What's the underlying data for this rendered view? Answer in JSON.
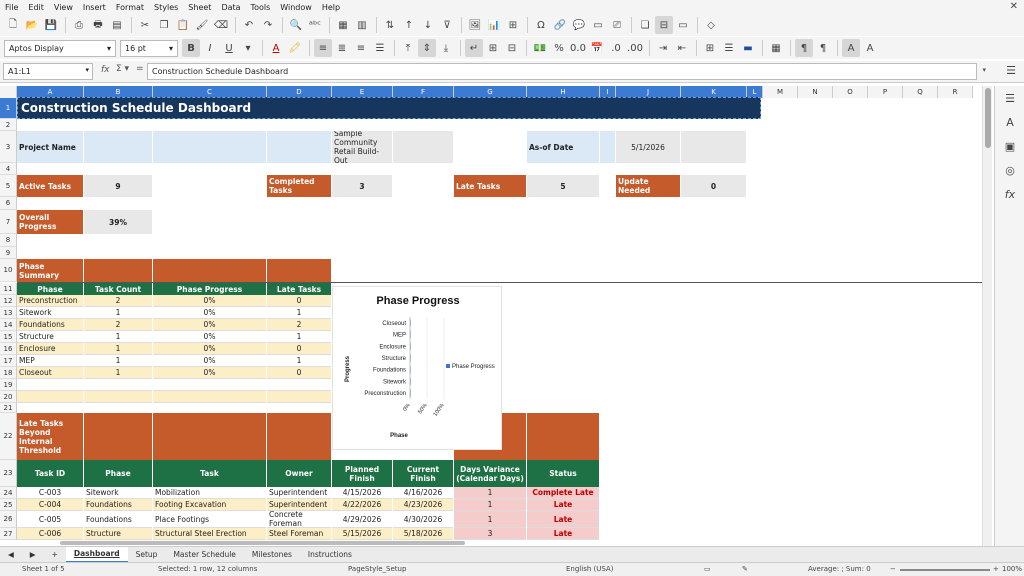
{
  "menu": [
    "File",
    "Edit",
    "View",
    "Insert",
    "Format",
    "Styles",
    "Sheet",
    "Data",
    "Tools",
    "Window",
    "Help"
  ],
  "font": {
    "name": "Aptos Display",
    "size": "16 pt"
  },
  "formula": {
    "cell_ref": "A1:L1",
    "content": "Construction Schedule Dashboard"
  },
  "columns": [
    "A",
    "B",
    "C",
    "D",
    "E",
    "F",
    "G",
    "H",
    "I",
    "J",
    "K",
    "L",
    "M",
    "N",
    "O",
    "P",
    "Q",
    "R"
  ],
  "rows": [
    "1",
    "2",
    "3",
    "4",
    "5",
    "6",
    "7",
    "8",
    "9",
    "10",
    "11",
    "12",
    "13",
    "14",
    "15",
    "16",
    "17",
    "18",
    "19",
    "20",
    "21",
    "22",
    "23",
    "24",
    "25",
    "26",
    "27"
  ],
  "title": "Construction Schedule Dashboard",
  "project": {
    "label": "Project Name",
    "name": "Sample Community Retail Build-Out",
    "asof_label": "As-of Date",
    "asof_value": "5/1/2026"
  },
  "kpis": {
    "active_label": "Active Tasks",
    "active_value": "9",
    "completed_label": "Completed Tasks",
    "completed_value": "3",
    "late_label": "Late Tasks",
    "late_value": "5",
    "update_label": "Update Needed",
    "update_value": "0",
    "progress_label": "Overall Progress",
    "progress_value": "39%"
  },
  "phase_summary": {
    "title": "Phase Summary",
    "headers": [
      "Phase",
      "Task Count",
      "Phase Progress",
      "Late Tasks"
    ],
    "rows": [
      [
        "Preconstruction",
        "2",
        "0%",
        "0"
      ],
      [
        "Sitework",
        "1",
        "0%",
        "1"
      ],
      [
        "Foundations",
        "2",
        "0%",
        "2"
      ],
      [
        "Structure",
        "1",
        "0%",
        "1"
      ],
      [
        "Enclosure",
        "1",
        "0%",
        "0"
      ],
      [
        "MEP",
        "1",
        "0%",
        "1"
      ],
      [
        "Closeout",
        "1",
        "0%",
        "0"
      ]
    ]
  },
  "late_tasks": {
    "title": "Late Tasks Beyond Internal Threshold",
    "headers": [
      "Task ID",
      "Phase",
      "Task",
      "Owner",
      "Planned Finish",
      "Current Finish",
      "Days Variance (Calendar Days)",
      "Status"
    ],
    "rows": [
      [
        "C-003",
        "Sitework",
        "Mobilization",
        "Superintendent",
        "4/15/2026",
        "4/16/2026",
        "1",
        "Complete Late"
      ],
      [
        "C-004",
        "Foundations",
        "Footing Excavation",
        "Superintendent",
        "4/22/2026",
        "4/23/2026",
        "1",
        "Late"
      ],
      [
        "C-005",
        "Foundations",
        "Place Footings",
        "Concrete Foreman",
        "4/29/2026",
        "4/30/2026",
        "1",
        "Late"
      ],
      [
        "C-006",
        "Structure",
        "Structural Steel Erection",
        "Steel Foreman",
        "5/15/2026",
        "5/18/2026",
        "3",
        "Late"
      ]
    ]
  },
  "chart_data": {
    "type": "bar",
    "title": "Phase Progress",
    "categories": [
      "Closeout",
      "MEP",
      "Enclosure",
      "Structure",
      "Foundations",
      "Sitework",
      "Preconstruction"
    ],
    "series": [
      {
        "name": "Phase Progress",
        "values": [
          0,
          0,
          0,
          0,
          0,
          0,
          0
        ]
      }
    ],
    "xlabel": "Phase",
    "ylabel": "Progress",
    "x_ticks": [
      "0%",
      "50%",
      "100%"
    ],
    "xlim": [
      0,
      1
    ],
    "legend": "right",
    "color": "#4472c4"
  },
  "tabs": [
    "Dashboard",
    "Setup",
    "Master Schedule",
    "Milestones",
    "Instructions"
  ],
  "status": {
    "sheet": "Sheet 1 of 5",
    "selected": "Selected: 1 row, 12 columns",
    "page_style": "PageStyle_Setup",
    "language": "English (USA)",
    "summary": "Average: ; Sum: 0",
    "zoom": "100%"
  }
}
